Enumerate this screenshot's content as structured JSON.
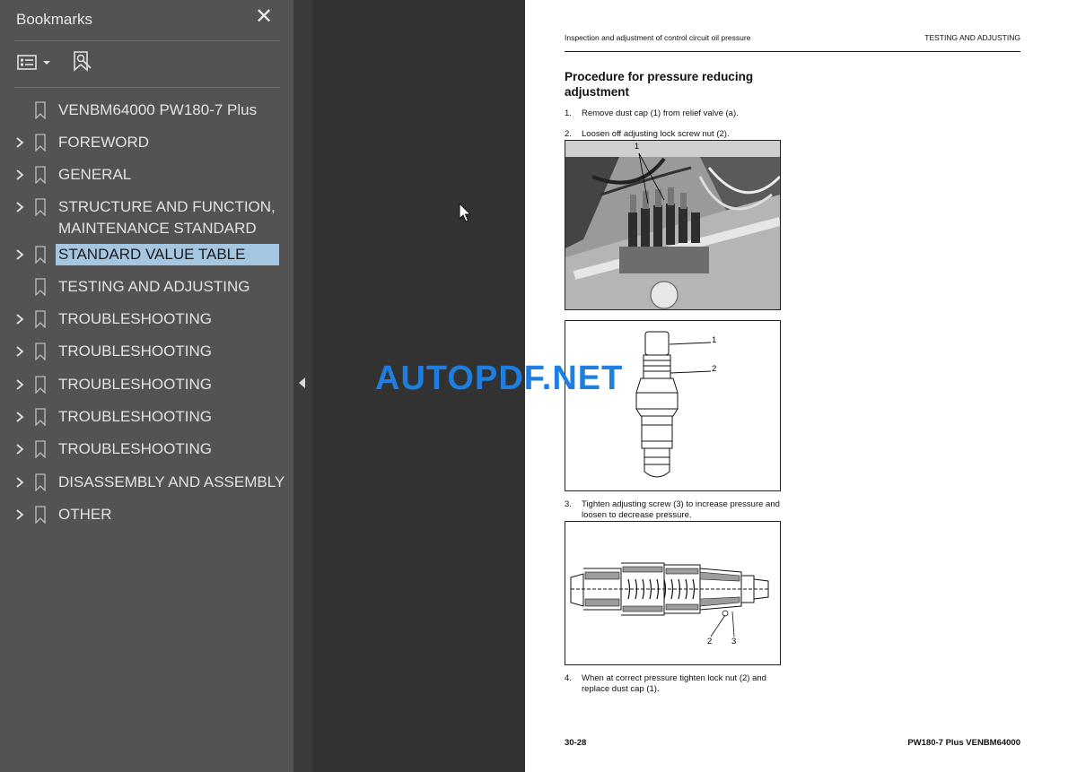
{
  "sidebar": {
    "title": "Bookmarks",
    "close_glyph": "✕",
    "toolbar": {
      "options_icon": "list-options-icon",
      "find_icon": "find-bookmark-icon"
    },
    "items": [
      {
        "label": "VENBM64000 PW180-7 Plus",
        "has_children": false,
        "selected": false
      },
      {
        "label": "FOREWORD",
        "has_children": true,
        "selected": false
      },
      {
        "label": "GENERAL",
        "has_children": true,
        "selected": false
      },
      {
        "label": "STRUCTURE AND FUNCTION,",
        "label2": "MAINTENANCE STANDARD",
        "has_children": true,
        "selected": false
      },
      {
        "label": "STANDARD VALUE TABLE",
        "has_children": true,
        "selected": true
      },
      {
        "label": "TESTING AND ADJUSTING",
        "has_children": false,
        "selected": false
      },
      {
        "label": "TROUBLESHOOTING",
        "has_children": true,
        "selected": false
      },
      {
        "label": "TROUBLESHOOTING",
        "has_children": true,
        "selected": false
      },
      {
        "label": "TROUBLESHOOTING",
        "has_children": true,
        "selected": false
      },
      {
        "label": "TROUBLESHOOTING",
        "has_children": true,
        "selected": false
      },
      {
        "label": "TROUBLESHOOTING",
        "has_children": true,
        "selected": false
      },
      {
        "label": "DISASSEMBLY AND ASSEMBLY",
        "has_children": true,
        "selected": false
      },
      {
        "label": "OTHER",
        "has_children": true,
        "selected": false
      }
    ]
  },
  "document": {
    "header_left": "Inspection and adjustment of control circuit oil pressure",
    "header_right": "TESTING AND ADJUSTING",
    "procedure_title": "Procedure for pressure reducing adjustment",
    "steps": [
      {
        "num": "1.",
        "text": "Remove dust cap (1) from relief valve (a)."
      },
      {
        "num": "2.",
        "text": "Loosen off adjusting lock screw nut (2)."
      },
      {
        "num": "3.",
        "text": "Tighten adjusting screw (3) to increase pressure and loosen to decrease pressure."
      },
      {
        "num": "4.",
        "text": "When at correct pressure tighten lock nut (2) and replace dust cap (1)."
      }
    ],
    "figure_callouts": {
      "photo": "1",
      "valve_1": "1",
      "valve_2": "2",
      "section_2": "2",
      "section_3": "3"
    },
    "footer_left": "30-28",
    "footer_right": "PW180-7 Plus  VENBM64000"
  },
  "watermark": "AUTOPDF.NET",
  "colors": {
    "sidebar_bg": "#535353",
    "viewer_bg": "#323232",
    "selection": "#a5c6e0",
    "watermark": "#1e7fe0"
  }
}
